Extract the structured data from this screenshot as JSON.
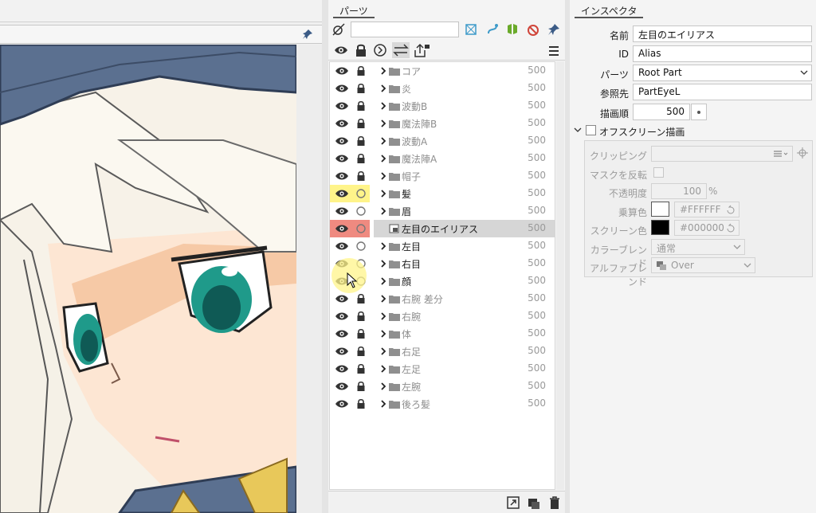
{
  "parts_panel": {
    "tab_label": "パーツ",
    "search_value": "",
    "rows": [
      {
        "name": "コア",
        "value": "500",
        "locked": true,
        "kind": "folder",
        "muted": true
      },
      {
        "name": "炎",
        "value": "500",
        "locked": true,
        "kind": "folder",
        "muted": true
      },
      {
        "name": "波動B",
        "value": "500",
        "locked": true,
        "kind": "folder",
        "muted": true
      },
      {
        "name": "魔法陣B",
        "value": "500",
        "locked": true,
        "kind": "folder",
        "muted": true
      },
      {
        "name": "波動A",
        "value": "500",
        "locked": true,
        "kind": "folder",
        "muted": true
      },
      {
        "name": "魔法陣A",
        "value": "500",
        "locked": true,
        "kind": "folder",
        "muted": true
      },
      {
        "name": "帽子",
        "value": "500",
        "locked": true,
        "kind": "folder",
        "muted": true
      },
      {
        "name": "髪",
        "value": "500",
        "locked": false,
        "kind": "folder",
        "muted": false,
        "highlight": "#fff48a"
      },
      {
        "name": "眉",
        "value": "500",
        "locked": false,
        "kind": "folder",
        "muted": false
      },
      {
        "name": "左目のエイリアス",
        "value": "500",
        "locked": false,
        "kind": "alias",
        "muted": false,
        "highlight": "#ef8a80",
        "selected": true
      },
      {
        "name": "左目",
        "value": "500",
        "locked": false,
        "kind": "folder",
        "muted": false
      },
      {
        "name": "右目",
        "value": "500",
        "locked": false,
        "kind": "folder",
        "muted": false
      },
      {
        "name": "顔",
        "value": "500",
        "locked": false,
        "kind": "folder",
        "muted": false
      },
      {
        "name": "右腕 差分",
        "value": "500",
        "locked": true,
        "kind": "folder",
        "muted": true
      },
      {
        "name": "右腕",
        "value": "500",
        "locked": true,
        "kind": "folder",
        "muted": true
      },
      {
        "name": "体",
        "value": "500",
        "locked": true,
        "kind": "folder",
        "muted": true
      },
      {
        "name": "右足",
        "value": "500",
        "locked": true,
        "kind": "folder",
        "muted": true
      },
      {
        "name": "左足",
        "value": "500",
        "locked": true,
        "kind": "folder",
        "muted": true
      },
      {
        "name": "左腕",
        "value": "500",
        "locked": true,
        "kind": "folder",
        "muted": true
      },
      {
        "name": "後ろ髪",
        "value": "500",
        "locked": true,
        "kind": "folder",
        "muted": true
      }
    ]
  },
  "inspector": {
    "tab_label": "インスペクタ",
    "name_label": "名前",
    "name_value": "左目のエイリアス",
    "id_label": "ID",
    "id_value": "Alias",
    "parts_label": "パーツ",
    "parts_value": "Root Part",
    "ref_label": "参照先",
    "ref_value": "PartEyeL",
    "draw_order_label": "描画順",
    "draw_order_value": "500",
    "offscreen_label": "オフスクリーン描画",
    "clipping_label": "クリッピング",
    "mask_invert_label": "マスクを反転",
    "opacity_label": "不透明度",
    "opacity_value": "100",
    "opacity_unit": "%",
    "multiply_label": "乗算色",
    "multiply_value": "#FFFFFF",
    "screen_label": "スクリーン色",
    "screen_value": "#000000",
    "color_blend_label": "カラーブレンド",
    "color_blend_value": "通常",
    "alpha_blend_label": "アルファブレンド",
    "alpha_blend_value": "Over"
  },
  "colors": {
    "accent_icon": "#3d9ac9",
    "green_icon": "#6aaa2a",
    "red_icon": "#d0453a",
    "highlight_yellow": "#fff48a",
    "highlight_red": "#ef8a80",
    "selected_row": "#d6d6d6"
  }
}
